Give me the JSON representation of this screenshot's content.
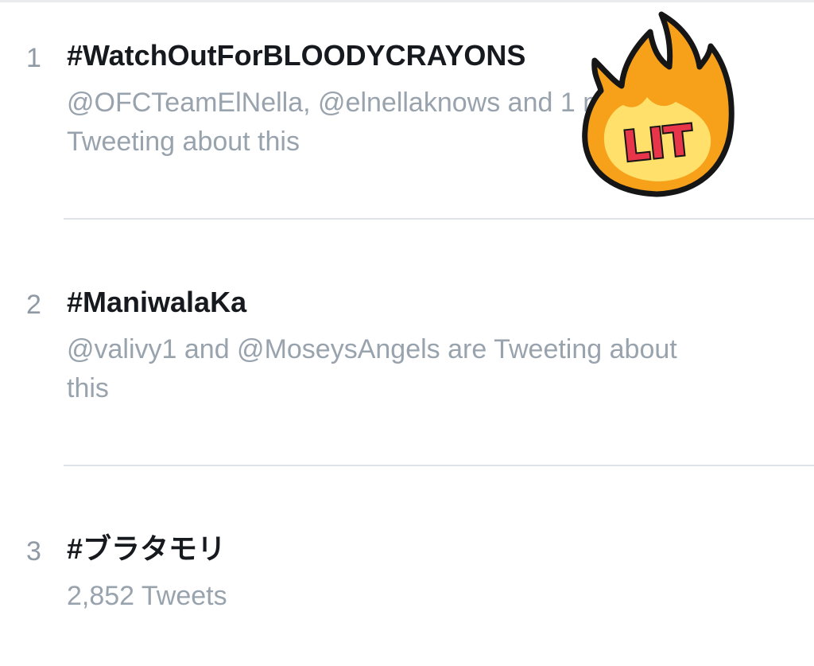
{
  "trends": [
    {
      "rank": "1",
      "hashtag": "#WatchOutForBLOODYCRAYONS",
      "meta": "@OFCTeamElNella, @elnellaknows and 1 more are Tweeting about this"
    },
    {
      "rank": "2",
      "hashtag": "#ManiwalaKa",
      "meta": "@valivy1 and @MoseysAngels are Tweeting about this"
    },
    {
      "rank": "3",
      "hashtag": "#ブラタモリ",
      "meta": "2,852 Tweets"
    }
  ],
  "sticker": {
    "text": "LIT",
    "icon": "fire-icon",
    "flame_color": "#f7a11b",
    "inner_color": "#ffe06a",
    "text_color": "#e8354a"
  }
}
